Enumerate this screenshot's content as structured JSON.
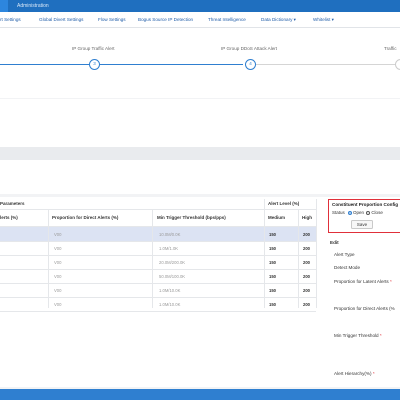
{
  "topbar": {
    "admin": "Administration"
  },
  "nav": [
    "rt Settings",
    "Global Divert Settings",
    "Flow Settings",
    "Bogus Source IP Detection",
    "Threat Intelligence",
    "Data Dictionary ▾",
    "Whitelist ▾"
  ],
  "steps": [
    {
      "label": "IP Group Traffic Alert",
      "num": "3"
    },
    {
      "label": "IP Group DDoS Attack Alert",
      "num": "4"
    },
    {
      "label": "Traffic",
      "num": ""
    }
  ],
  "table": {
    "group_header": "Parameters",
    "alert_level_header": "Alert Level (%)",
    "col_latent": "lerts (%)",
    "col_direct": "Proportion for Direct Alerts (%)",
    "col_threshold": "Min Trigger Threshold (bps/pps)",
    "col_medium": "Medium",
    "col_high": "High",
    "rows": [
      {
        "direct": "V00",
        "threshold": "10.0M/0.0K",
        "medium": "150",
        "high": "200"
      },
      {
        "direct": "V00",
        "threshold": "1.0M/1.0K",
        "medium": "150",
        "high": "200"
      },
      {
        "direct": "V00",
        "threshold": "20.0M/200.0K",
        "medium": "150",
        "high": "200"
      },
      {
        "direct": "V00",
        "threshold": "50.0M/100.0K",
        "medium": "150",
        "high": "200"
      },
      {
        "direct": "V00",
        "threshold": "1.0M/10.0K",
        "medium": "150",
        "high": "200"
      },
      {
        "direct": "V00",
        "threshold": "1.0M/10.0K",
        "medium": "150",
        "high": "200"
      }
    ]
  },
  "config": {
    "title": "Constituent Proportion Config",
    "status_label": "Status",
    "open_label": "Open",
    "close_label": "Close",
    "save_label": "Save"
  },
  "edit": {
    "title": "Edit",
    "alert_type": "Alert Type",
    "detect_mode": "Detect Mode",
    "latent": "Proportion for Latent Alerts",
    "direct": "Proportion for Direct Alerts (%",
    "min_trigger": "Min Trigger Threshold",
    "hierarchy": "Alert Hierarchy(%)",
    "required_mark": "*"
  },
  "colors": {
    "primary": "#1f6fbf",
    "accent": "#2f7fd0",
    "highlight_border": "#e0303a",
    "selected_row": "#dce3f3"
  }
}
